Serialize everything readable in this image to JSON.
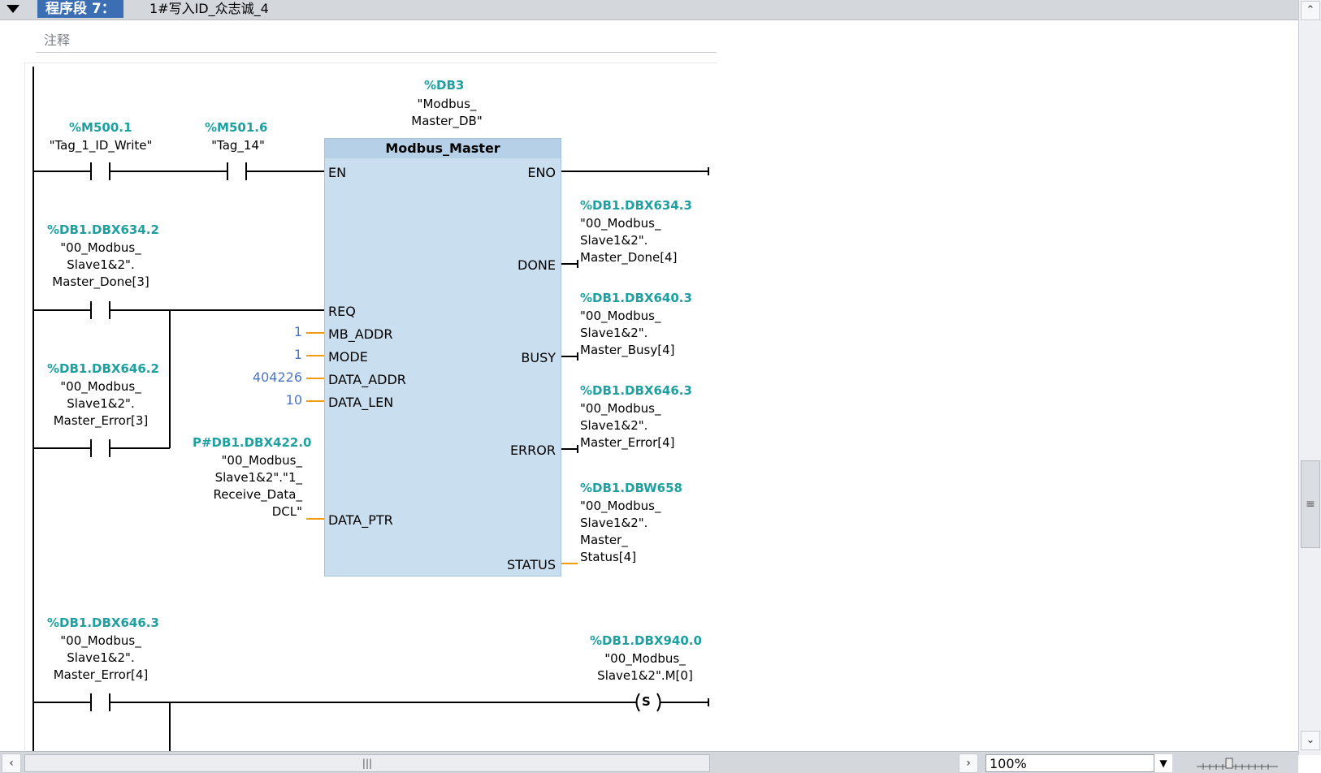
{
  "network": {
    "label": "程序段 7：",
    "title": "1#写入ID_众志诚_4",
    "comment_placeholder": "注释"
  },
  "instance_db": {
    "addr": "%DB3",
    "name_line1": "\"Modbus_",
    "name_line2": "Master_DB\""
  },
  "fb": {
    "title": "Modbus_Master",
    "inputs": [
      "EN",
      "REQ",
      "MB_ADDR",
      "MODE",
      "DATA_ADDR",
      "DATA_LEN",
      "DATA_PTR"
    ],
    "outputs": [
      "ENO",
      "DONE",
      "BUSY",
      "ERROR",
      "STATUS"
    ]
  },
  "contacts": {
    "m500": {
      "addr": "%M500.1",
      "sym": "\"Tag_1_ID_Write\""
    },
    "m501": {
      "addr": "%M501.6",
      "sym": "\"Tag_14\""
    },
    "dbx634_2": {
      "addr": "%DB1.DBX634.2",
      "sym": "\"00_Modbus_\nSlave1&2\".\nMaster_Done[3]"
    },
    "dbx646_2": {
      "addr": "%DB1.DBX646.2",
      "sym": "\"00_Modbus_\nSlave1&2\".\nMaster_Error[3]"
    },
    "dbx646_3_contact": {
      "addr": "%DB1.DBX646.3",
      "sym": "\"00_Modbus_\nSlave1&2\".\nMaster_Error[4]"
    }
  },
  "input_values": {
    "mb_addr": "1",
    "mode": "1",
    "data_addr": "404226",
    "data_len": "10",
    "data_ptr_addr": "P#DB1.DBX422.0",
    "data_ptr_sym": "\"00_Modbus_\nSlave1&2\".\"1_\nReceive_Data_\nDCL\""
  },
  "outputs": {
    "done": {
      "addr": "%DB1.DBX634.3",
      "sym": "\"00_Modbus_\nSlave1&2\".\nMaster_Done[4]"
    },
    "busy": {
      "addr": "%DB1.DBX640.3",
      "sym": "\"00_Modbus_\nSlave1&2\".\nMaster_Busy[4]"
    },
    "error": {
      "addr": "%DB1.DBX646.3",
      "sym": "\"00_Modbus_\nSlave1&2\".\nMaster_Error[4]"
    },
    "status": {
      "addr": "%DB1.DBW658",
      "sym": "\"00_Modbus_\nSlave1&2\".\nMaster_\nStatus[4]"
    }
  },
  "coil": {
    "addr": "%DB1.DBX940.0",
    "sym": "\"00_Modbus_\nSlave1&2\".M[0]",
    "type": "S"
  },
  "statusbar": {
    "zoom": "100%"
  },
  "colors": {
    "operand_addr": "#1ea0a0",
    "constant": "#4a74c9",
    "wire_input": "#f39c12",
    "fb_body": "#c9dff0",
    "network_label_bg": "#3c6eb4"
  }
}
